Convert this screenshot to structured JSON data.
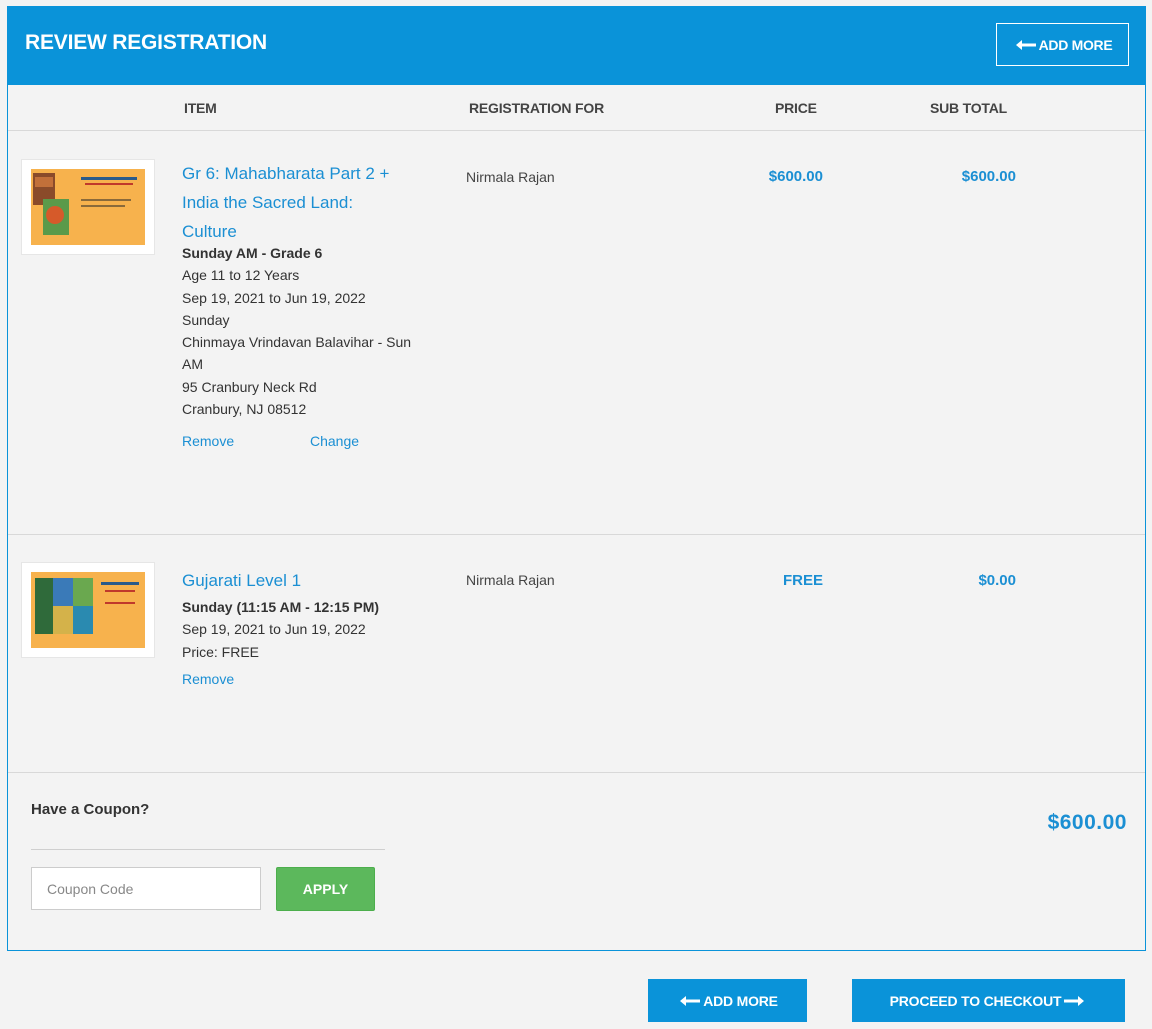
{
  "header": {
    "title": "REVIEW REGISTRATION",
    "add_more": "ADD MORE"
  },
  "columns": {
    "item": "ITEM",
    "registration_for": "REGISTRATION FOR",
    "price": "PRICE",
    "sub_total": "SUB TOTAL"
  },
  "items": [
    {
      "title_lines": [
        "Gr 6: Mahabharata Part 2 +",
        "India the Sacred Land:",
        "Culture"
      ],
      "details": [
        "Sunday AM - Grade 6",
        "Age 11 to 12 Years",
        "Sep 19, 2021 to Jun 19, 2022",
        "Sunday",
        "Chinmaya Vrindavan Balavihar - Sun",
        "AM",
        "95 Cranbury Neck Rd",
        "Cranbury, NJ 08512"
      ],
      "remove": "Remove",
      "change": "Change",
      "registration_for": "Nirmala Rajan",
      "price": "$600.00",
      "subtotal": "$600.00"
    },
    {
      "title_lines": [
        "Gujarati Level 1"
      ],
      "details": [
        "Sunday (11:15 AM - 12:15 PM)",
        "Sep 19, 2021 to Jun 19, 2022",
        "Price: FREE"
      ],
      "remove": "Remove",
      "registration_for": "Nirmala Rajan",
      "price": "FREE",
      "subtotal": "$0.00"
    }
  ],
  "coupon": {
    "title": "Have a Coupon?",
    "placeholder": "Coupon Code",
    "apply": "APPLY"
  },
  "total": "$600.00",
  "footer": {
    "add_more": "ADD MORE",
    "checkout": "PROCEED TO CHECKOUT"
  },
  "colors": {
    "primary": "#0a93d9",
    "link": "#1b8fd3",
    "apply": "#5cb85c"
  }
}
